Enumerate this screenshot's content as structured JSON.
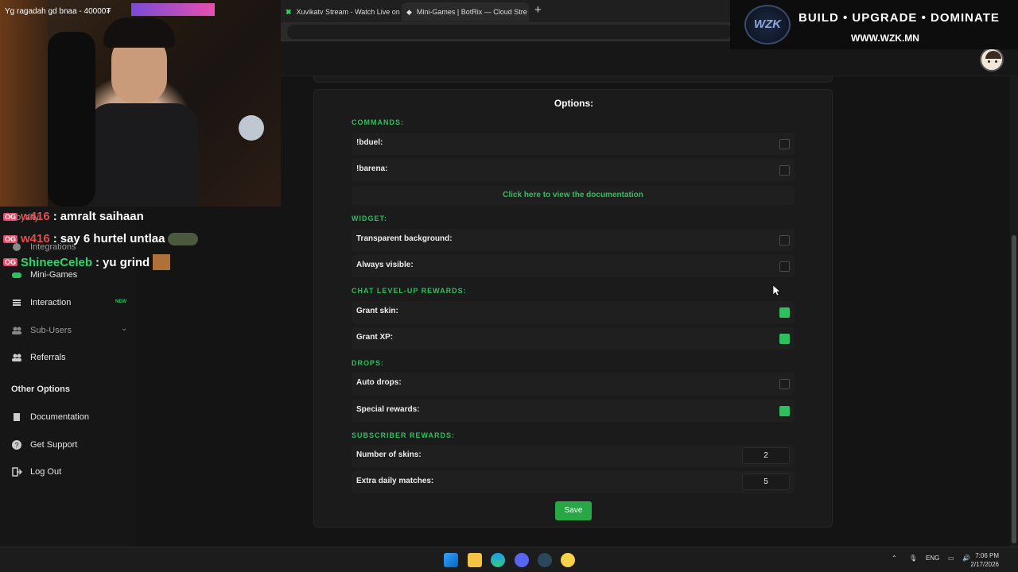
{
  "browser": {
    "tabs": [
      {
        "title": "Xuvikatv Stream - Watch Live on K"
      },
      {
        "title": "Mini-Games | BotRix — Cloud Stre"
      }
    ]
  },
  "banner": {
    "logo_text": "WZK",
    "line1": "BUILD • UPGRADE • DOMINATE",
    "line2": "WWW.WZK.MN"
  },
  "webcam": {
    "overlay_text": "Yg ragadah gd bnaa - 40000₮"
  },
  "chat": [
    {
      "user": "w416",
      "message": "amralt saihaan",
      "user_color": "#e84a4a"
    },
    {
      "user": "w416",
      "message": "say 6 hurtel untlaa",
      "user_color": "#e84a4a"
    },
    {
      "user": "ShineeCeleb",
      "message": "yu grind",
      "user_color": "#2fd66a"
    }
  ],
  "sidebar": {
    "items": [
      {
        "label": "Loyalty"
      },
      {
        "label": "Integrations"
      },
      {
        "label": "Mini-Games"
      },
      {
        "label": "Interaction",
        "badge": "NEW"
      },
      {
        "label": "Sub-Users"
      },
      {
        "label": "Referrals"
      }
    ],
    "other_header": "Other Options",
    "other": [
      {
        "label": "Documentation"
      },
      {
        "label": "Get Support"
      },
      {
        "label": "Log Out"
      }
    ]
  },
  "options": {
    "title": "Options:",
    "commands_header": "COMMANDS:",
    "commands": [
      {
        "label": "!bduel:",
        "checked": false
      },
      {
        "label": "!barena:",
        "checked": false
      }
    ],
    "doc_link": "Click here to view the documentation",
    "widget_header": "WIDGET:",
    "widget": [
      {
        "label": "Transparent background:",
        "checked": false
      },
      {
        "label": "Always visible:",
        "checked": false
      }
    ],
    "levelup_header": "CHAT LEVEL-UP REWARDS:",
    "levelup": [
      {
        "label": "Grant skin:",
        "checked": true
      },
      {
        "label": "Grant XP:",
        "checked": true
      }
    ],
    "drops_header": "DROPS:",
    "drops": [
      {
        "label": "Auto drops:",
        "checked": false
      },
      {
        "label": "Special rewards:",
        "checked": true
      }
    ],
    "sub_header": "SUBSCRIBER REWARDS:",
    "sub": [
      {
        "label": "Number of skins:",
        "value": "2"
      },
      {
        "label": "Extra daily matches:",
        "value": "5"
      }
    ],
    "save_label": "Save"
  },
  "taskbar": {
    "lang": "ENG",
    "time": "7:06 PM",
    "date": "2/17/2026"
  },
  "colors": {
    "accent": "#2fbf5f",
    "save": "#28a745"
  }
}
